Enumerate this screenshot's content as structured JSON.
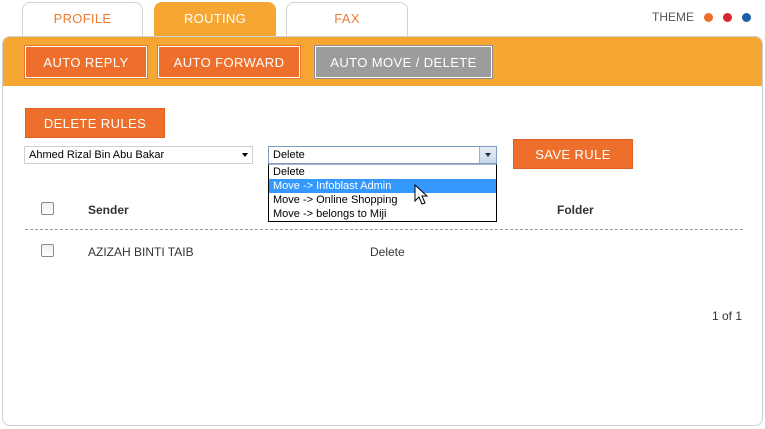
{
  "tabs": {
    "profile": "PROFILE",
    "routing": "ROUTING",
    "fax": "FAX"
  },
  "theme": {
    "label": "THEME",
    "colors": [
      "#ee6f2b",
      "#d72631",
      "#1f5fa8"
    ]
  },
  "subnav": {
    "auto_reply": "AUTO REPLY",
    "auto_forward": "AUTO FORWARD",
    "auto_move_delete": "AUTO MOVE / DELETE"
  },
  "buttons": {
    "delete_rules": "DELETE RULES",
    "save_rule": "SAVE RULE"
  },
  "user_select": {
    "value": "Ahmed Rizal Bin Abu Bakar"
  },
  "action_select": {
    "value": "Delete",
    "options": [
      "Delete",
      "Move -> Infoblast Admin",
      "Move -> Online Shopping",
      "Move -> belongs to Miji"
    ],
    "highlighted_index": 1
  },
  "table": {
    "headers": {
      "sender": "Sender",
      "folder": "Folder"
    },
    "rows": [
      {
        "sender": "AZIZAH BINTI TAIB",
        "action": "Delete"
      }
    ]
  },
  "pagination": "1 of 1"
}
